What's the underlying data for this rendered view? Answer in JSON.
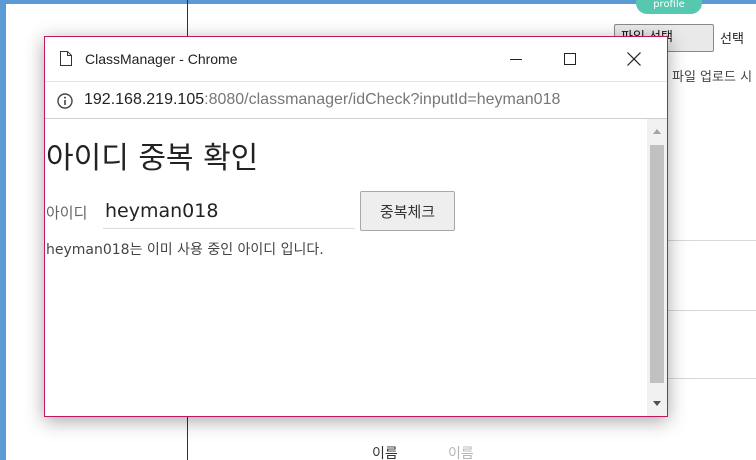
{
  "background": {
    "badge": "profile",
    "file_button_label": "파일 선택",
    "file_status": "선택",
    "upload_text": "파일 업로드 시",
    "name_label": "이름",
    "name_placeholder": "이름"
  },
  "window": {
    "title": "ClassManager - Chrome",
    "icons": {
      "page": "document-icon",
      "minimize": "minimize-icon",
      "maximize": "maximize-icon",
      "close": "close-icon"
    }
  },
  "address_bar": {
    "icon": "info-icon",
    "url_host": "192.168.219.105",
    "url_rest": ":8080/classmanager/idCheck?inputId=heyman018"
  },
  "page": {
    "title": "아이디 중복 확인",
    "id_label": "아이디",
    "id_value": "heyman018",
    "check_button": "중복체크",
    "result_message": "heyman018는 이미 사용 중인 아이디 입니다."
  },
  "colors": {
    "window_border": "#c2185b",
    "frame_accent": "#5b9bd5",
    "badge": "#56c8b0"
  }
}
